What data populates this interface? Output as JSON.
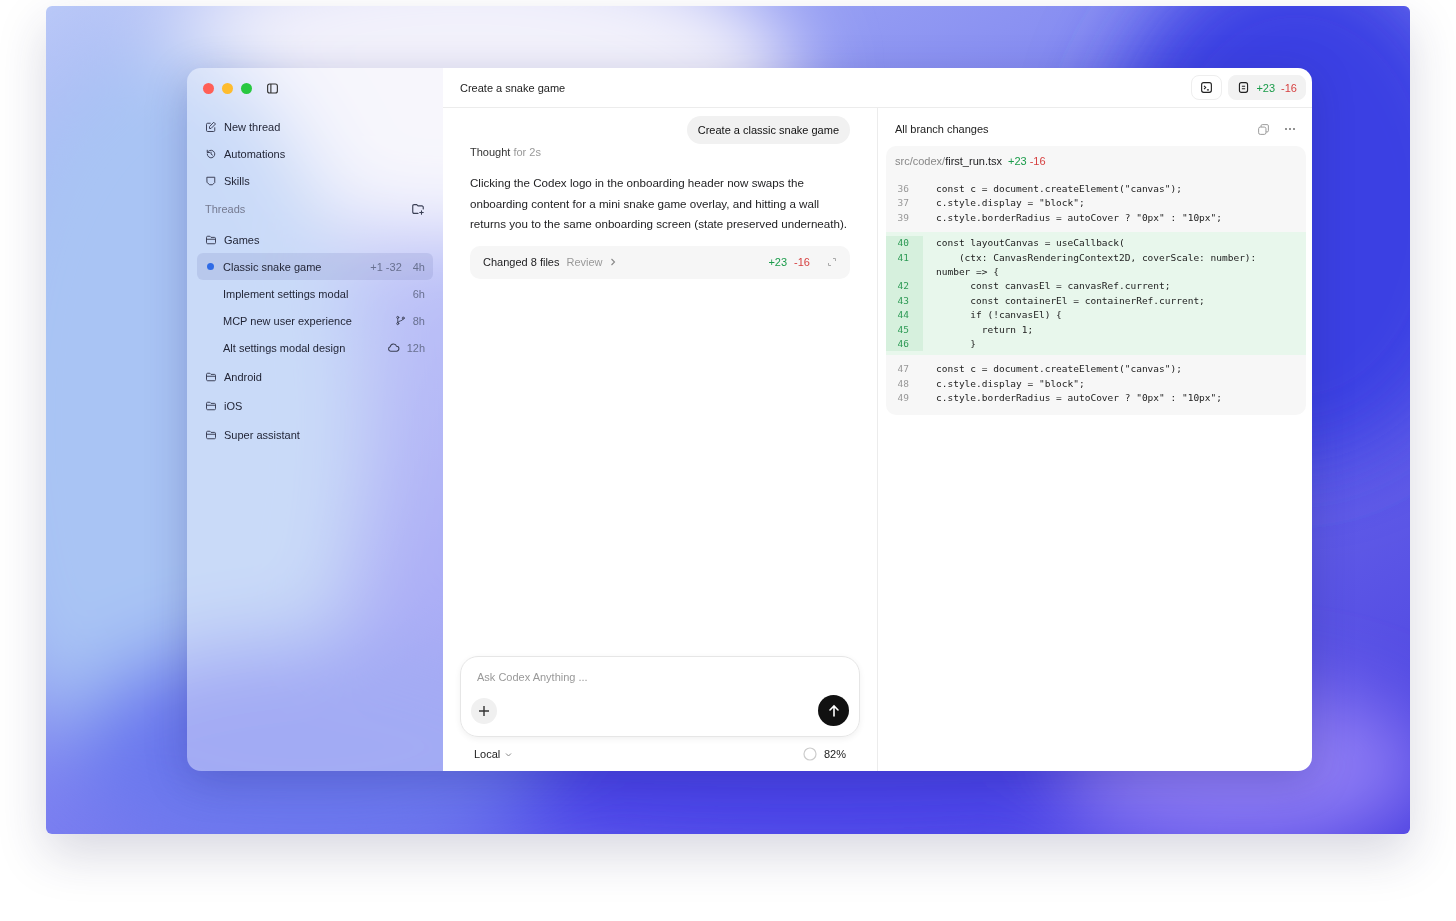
{
  "sidebar": {
    "nav": [
      {
        "label": "New thread"
      },
      {
        "label": "Automations"
      },
      {
        "label": "Skills"
      }
    ],
    "threads_heading": "Threads",
    "projects": [
      {
        "name": "Games",
        "children": [
          {
            "title": "Classic snake game",
            "selected": true,
            "unread": true,
            "changes": "+1 -32",
            "kind": "plain",
            "age": "4h"
          },
          {
            "title": "Implement settings modal",
            "selected": false,
            "unread": false,
            "kind": "plain",
            "age": "6h"
          },
          {
            "title": "MCP new user experience",
            "selected": false,
            "unread": false,
            "kind": "branch",
            "age": "8h"
          },
          {
            "title": "Alt settings modal design",
            "selected": false,
            "unread": false,
            "kind": "cloud",
            "age": "12h"
          }
        ]
      },
      {
        "name": "Android"
      },
      {
        "name": "iOS"
      },
      {
        "name": "Super assistant"
      }
    ]
  },
  "header": {
    "title": "Create a snake game",
    "added": "+23",
    "removed": "-16"
  },
  "chat": {
    "user_message": "Create a classic snake game",
    "thought_label": "Thought",
    "thought_time": "for 2s",
    "reply": "Clicking the Codex logo in the onboarding header now swaps the onboarding content for a mini snake game overlay, and hitting a wall returns you to the same onboarding screen (state preserved underneath).",
    "changes": {
      "label": "Changed 8 files",
      "link": "Review",
      "added": "+23",
      "removed": "-16"
    },
    "composer": {
      "placeholder": "Ask Codex Anything ..."
    },
    "mode": "Local",
    "context": "82%"
  },
  "diff": {
    "title": "All branch changes",
    "file": {
      "dir": "src/codex/",
      "name": "first_run.tsx",
      "added": "+23",
      "removed": "-16"
    },
    "hunks": [
      {
        "kind": "context",
        "lines": [
          {
            "number": "36",
            "code": "const c = document.createElement(\"canvas\");"
          },
          {
            "number": "37",
            "code": "c.style.display = \"block\";"
          },
          {
            "number": "39",
            "code": "c.style.borderRadius = autoCover ? \"0px\" : \"10px\";"
          }
        ]
      },
      {
        "kind": "added",
        "lines": [
          {
            "number": "40",
            "code": "const layoutCanvas = useCallback("
          },
          {
            "number": "41",
            "code": "    (ctx: CanvasRenderingContext2D, coverScale: number):"
          },
          {
            "code": "number => {"
          },
          {
            "number": "42",
            "code": "      const canvasEl = canvasRef.current;"
          },
          {
            "number": "43",
            "code": "      const containerEl = containerRef.current;"
          },
          {
            "number": "44",
            "code": "      if (!canvasEl) {"
          },
          {
            "number": "45",
            "code": "        return 1;"
          },
          {
            "number": "46",
            "code": "      }"
          }
        ]
      },
      {
        "kind": "context",
        "lines": [
          {
            "number": "47",
            "code": "const c = document.createElement(\"canvas\");"
          },
          {
            "number": "48",
            "code": "c.style.display = \"block\";"
          },
          {
            "number": "49",
            "code": "c.style.borderRadius = autoCover ? \"0px\" : \"10px\";"
          }
        ]
      }
    ]
  }
}
